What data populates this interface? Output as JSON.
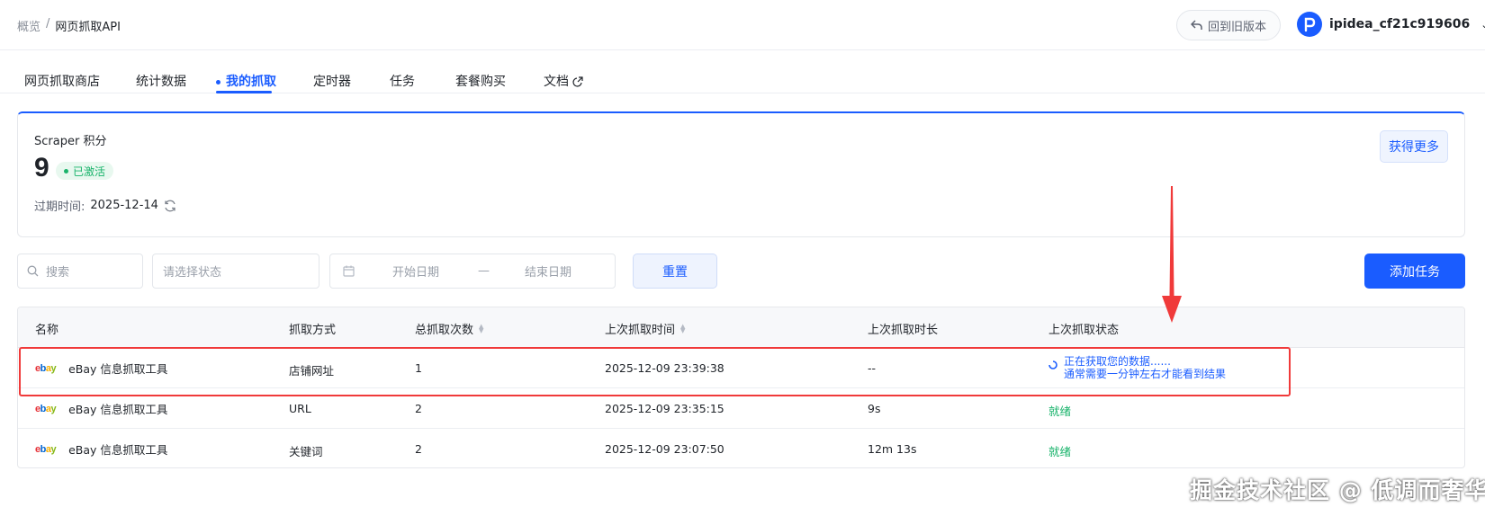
{
  "breadcrumb": {
    "parent": "概览",
    "separator": "/",
    "current": "网页抓取API"
  },
  "header": {
    "old_version": "回到旧版本",
    "username": "ipidea_cf21c919606"
  },
  "tabs": [
    {
      "label": "网页抓取商店"
    },
    {
      "label": "统计数据"
    },
    {
      "label": "我的抓取"
    },
    {
      "label": "定时器"
    },
    {
      "label": "任务"
    },
    {
      "label": "套餐购买"
    },
    {
      "label": "文档"
    }
  ],
  "credits": {
    "title": "Scraper 积分",
    "score": "9",
    "badge": "已激活",
    "expire_label": "过期时间:",
    "expire_date": "2025-12-14",
    "get_more": "获得更多"
  },
  "filters": {
    "search_placeholder": "搜索",
    "status_placeholder": "请选择状态",
    "start_date": "开始日期",
    "date_sep": "—",
    "end_date": "结束日期",
    "reset": "重置",
    "add_task": "添加任务"
  },
  "table": {
    "columns": [
      "名称",
      "抓取方式",
      "总抓取次数",
      "上次抓取时间",
      "上次抓取时长",
      "上次抓取状态"
    ],
    "rows": [
      {
        "name": "eBay 信息抓取工具",
        "method": "店铺网址",
        "count": "1",
        "time": "2025-12-09 23:39:38",
        "duration": "--",
        "status_line1": "正在获取您的数据......",
        "status_line2": "通常需要一分钟左右才能看到结果"
      },
      {
        "name": "eBay 信息抓取工具",
        "method": "URL",
        "count": "2",
        "time": "2025-12-09 23:35:15",
        "duration": "9s",
        "status": "就绪"
      },
      {
        "name": "eBay 信息抓取工具",
        "method": "关键词",
        "count": "2",
        "time": "2025-12-09 23:07:50",
        "duration": "12m 13s",
        "status": "就绪"
      }
    ]
  },
  "watermark": "掘金技术社区 @ 低调而奢华",
  "colors": {
    "accent": "#1a5cff",
    "success": "#19b36b",
    "highlight": "#f03a3a"
  }
}
